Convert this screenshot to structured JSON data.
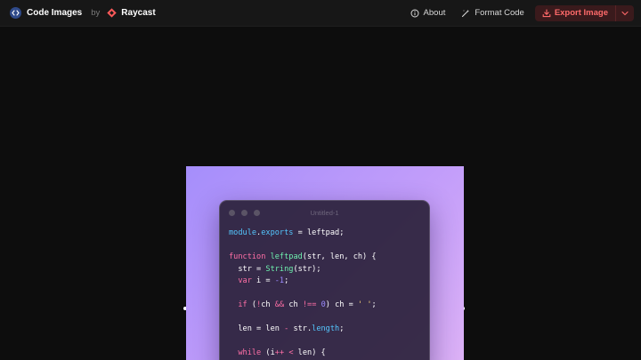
{
  "header": {
    "app_title": "Code Images",
    "by_text": "by",
    "org_name": "Raycast",
    "about_label": "About",
    "format_label": "Format Code",
    "export_label": "Export Image"
  },
  "editor": {
    "window_title": "Untitled-1",
    "lines": [
      [
        [
          "prop",
          "module"
        ],
        [
          "pl",
          "."
        ],
        [
          "prop",
          "exports"
        ],
        [
          "pl",
          " = leftpad;"
        ]
      ],
      [],
      [
        [
          "kw",
          "function "
        ],
        [
          "fn",
          "leftpad"
        ],
        [
          "pl",
          "(str, len, ch) {"
        ]
      ],
      [
        [
          "pl",
          "  str = "
        ],
        [
          "fn",
          "String"
        ],
        [
          "pl",
          "(str);"
        ]
      ],
      [
        [
          "kw",
          "  var "
        ],
        [
          "pl",
          "i = "
        ],
        [
          "num",
          "-1"
        ],
        [
          "pl",
          ";"
        ]
      ],
      [],
      [
        [
          "kw",
          "  if "
        ],
        [
          "pl",
          "("
        ],
        [
          "kw",
          "!"
        ],
        [
          "pl",
          "ch "
        ],
        [
          "kw",
          "&&"
        ],
        [
          "pl",
          " ch "
        ],
        [
          "kw",
          "!=="
        ],
        [
          "pl",
          " "
        ],
        [
          "num",
          "0"
        ],
        [
          "pl",
          ") ch = "
        ],
        [
          "str",
          "' '"
        ],
        [
          "pl",
          ";"
        ]
      ],
      [],
      [
        [
          "pl",
          "  len = len "
        ],
        [
          "kw",
          "-"
        ],
        [
          "pl",
          " str."
        ],
        [
          "prop",
          "length"
        ],
        [
          "pl",
          ";"
        ]
      ],
      [],
      [
        [
          "kw",
          "  while "
        ],
        [
          "pl",
          "(i"
        ],
        [
          "kw",
          "++"
        ],
        [
          "pl",
          " "
        ],
        [
          "kw",
          "<"
        ],
        [
          "pl",
          " len) {"
        ]
      ]
    ]
  },
  "colors": {
    "accent": "#ff6a6a",
    "background_gradient_start": "#a58efb",
    "background_gradient_end": "#dcb1f6",
    "keyword": "#ff6fa6",
    "function": "#6ff3b0",
    "property": "#54c7ff",
    "number": "#9c8cff",
    "string": "#ffd97a"
  },
  "icons": {
    "brand": "code-brackets-icon",
    "raycast": "raycast-logo-icon",
    "about": "info-icon",
    "format": "magic-wand-icon",
    "export": "download-icon",
    "export_menu": "chevron-down-icon"
  }
}
